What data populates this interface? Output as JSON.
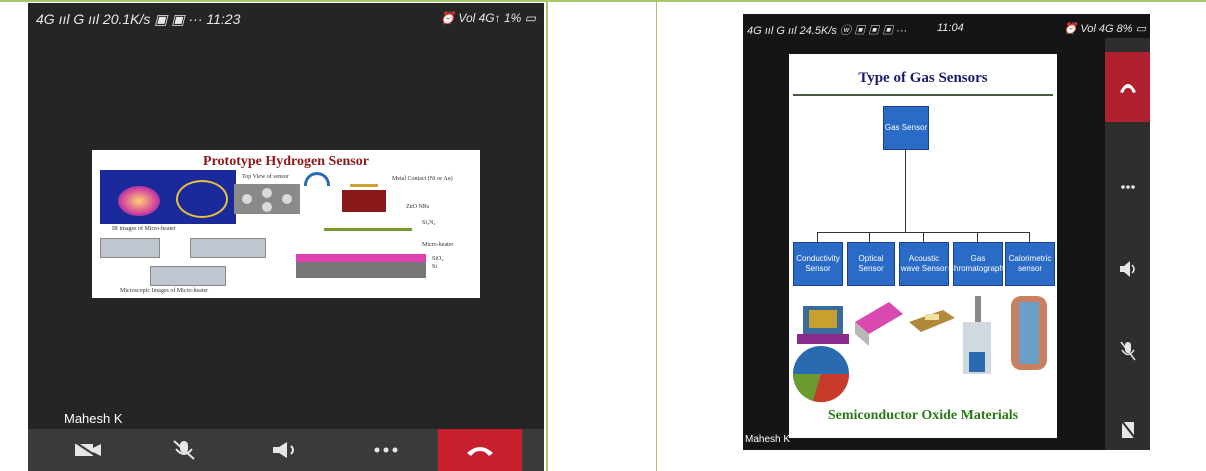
{
  "left_call": {
    "status": {
      "left": "4G ııl  G ııl  20.1K/s ▣ ▣ ··· 11:23",
      "right": "⏰ Vol 4G↑ 1% ▭"
    },
    "slide": {
      "title": "Prototype Hydrogen Sensor",
      "caption_ir": "IR images of Micro-heater",
      "caption_top": "Top View of sensor",
      "caption_metal": "Metal Contact (Ni or Au)",
      "caption_zno": "ZnO NRs",
      "caption_si3n4": "Si₃N₄",
      "caption_microheater": "Micro-heater",
      "caption_sio2": "SiO₂",
      "caption_si": "Si",
      "caption_micro": "Microscopic Images of Micro-heater"
    },
    "participant_name": "Mahesh K",
    "toolbar": {
      "video_off_label": "video off",
      "mic_off_label": "mic off",
      "speaker_label": "speaker",
      "more_label": "more",
      "end_label": "end call"
    }
  },
  "right_call": {
    "status": {
      "left": "4G ııl G ııl 24.5K/s ⓦ ▣ ▣ ▣ ···",
      "time": "11:04",
      "right": "⏰ Vol 4G 8% ▭"
    },
    "slide": {
      "title": "Type of Gas Sensors",
      "root": "Gas Sensor",
      "children": [
        "Conductivity Sensor",
        "Optical Sensor",
        "Acoustic wave Sensor",
        "Gas Chromatography",
        "Calorimetric sensor"
      ],
      "footer": "Semiconductor Oxide Materials"
    },
    "participant_name": "Mahesh K"
  },
  "colors": {
    "end_call": "#c8202e",
    "node_blue": "#2a6bc8",
    "slide_title_left": "#8b1a1a",
    "slide_title_right": "#1a1a70",
    "footer_green": "#2a7a1a"
  }
}
